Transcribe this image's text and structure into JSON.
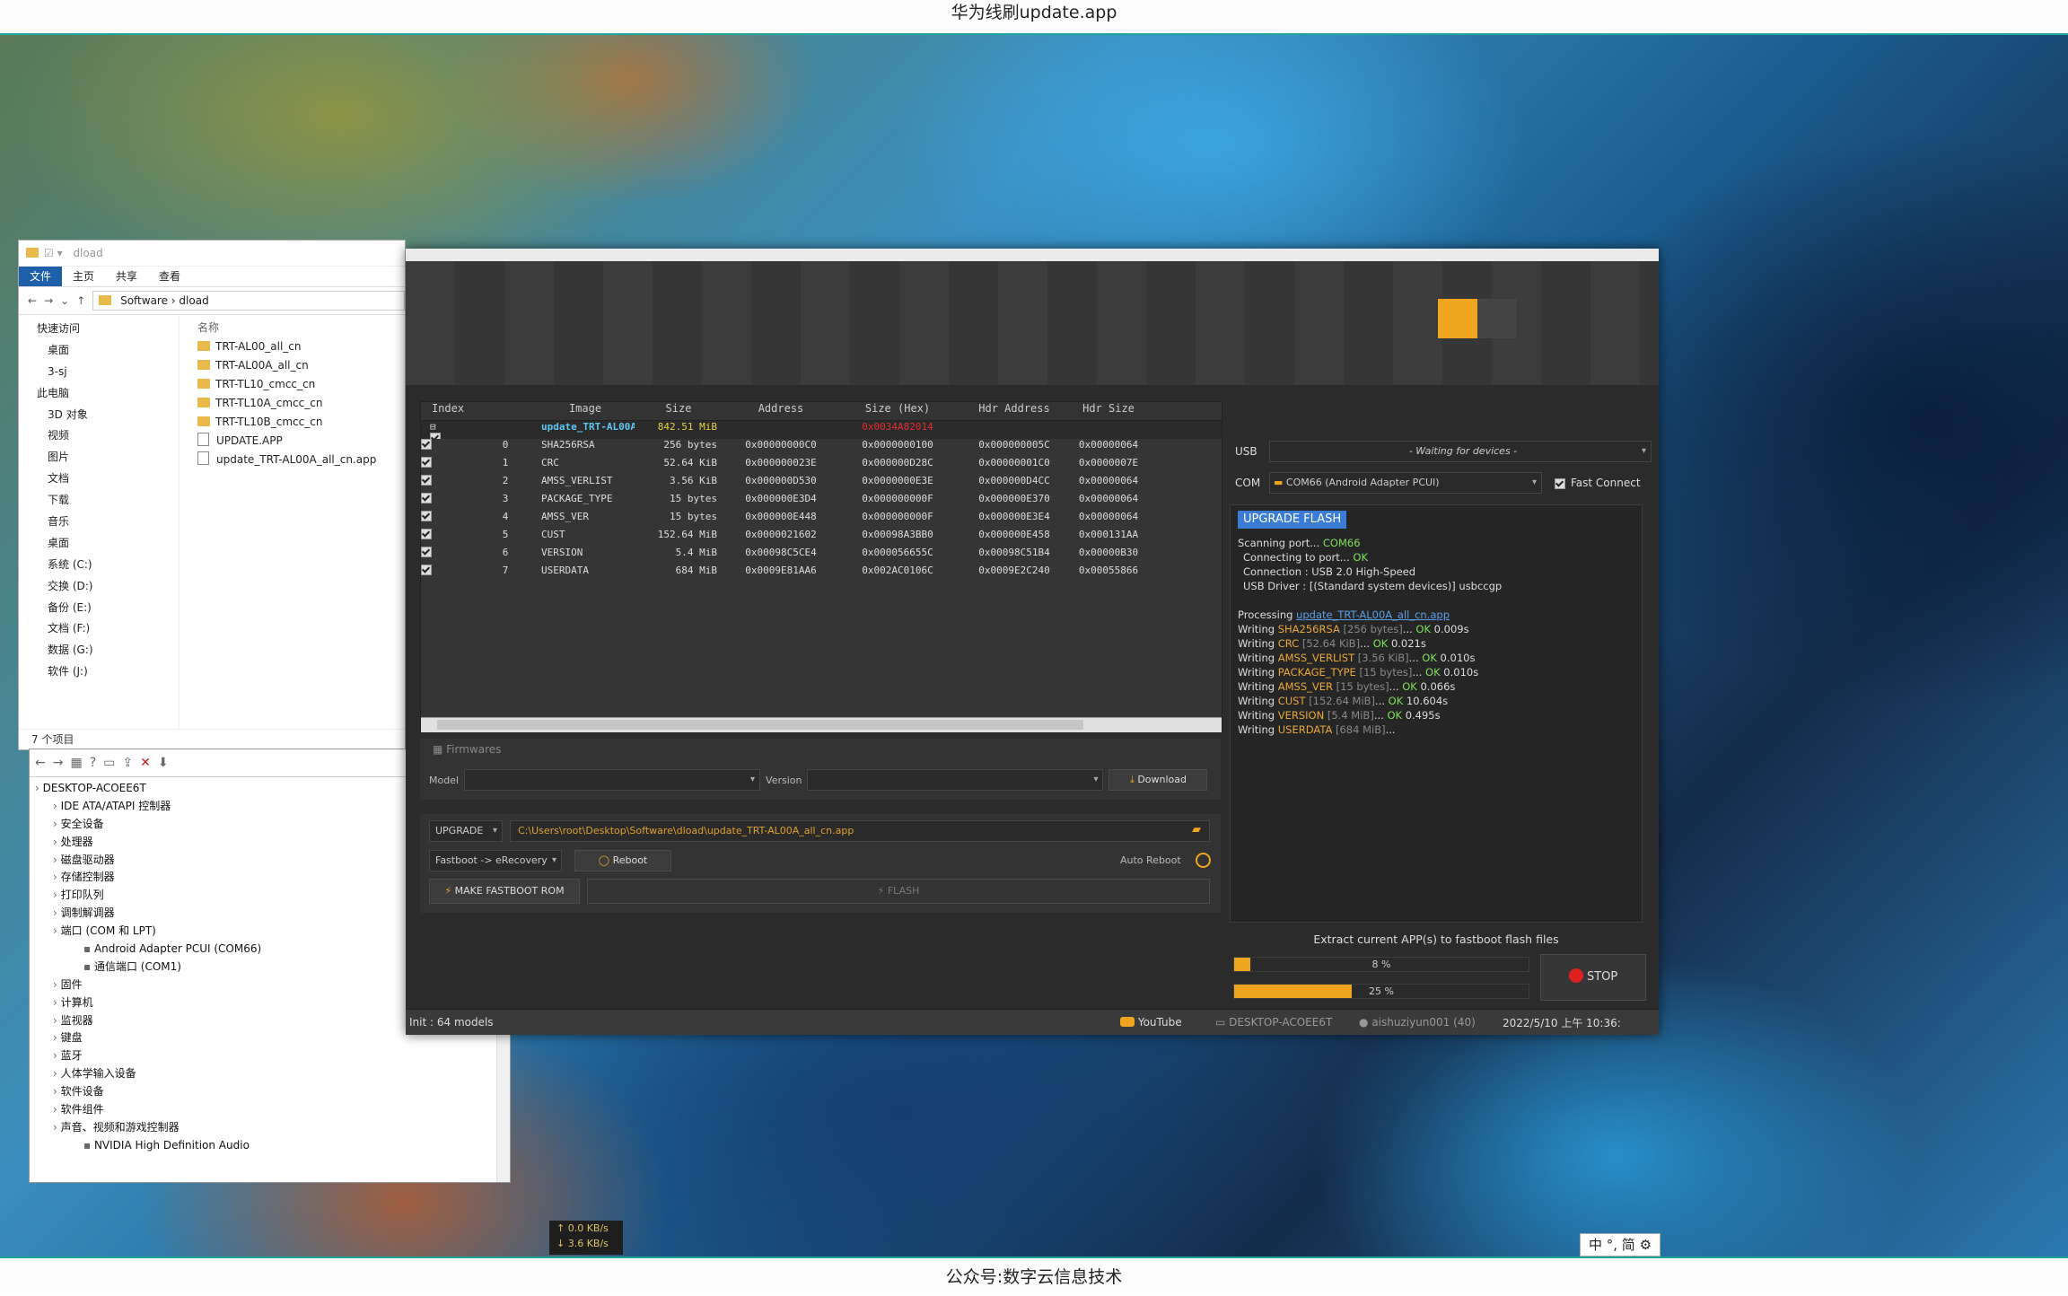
{
  "page": {
    "top_title": "华为线刷update.app",
    "bottom_caption": "公众号:数字云信息技术"
  },
  "explorer": {
    "title": "dload",
    "tabs": [
      "文件",
      "主页",
      "共享",
      "查看"
    ],
    "breadcrumb": [
      "Software",
      "dload"
    ],
    "column_name": "名称",
    "nav": [
      {
        "label": "快速访问",
        "level": 0
      },
      {
        "label": "桌面",
        "level": 1
      },
      {
        "label": "3-sj",
        "level": 1
      },
      {
        "label": "此电脑",
        "level": 0
      },
      {
        "label": "3D 对象",
        "level": 1
      },
      {
        "label": "视频",
        "level": 1
      },
      {
        "label": "图片",
        "level": 1
      },
      {
        "label": "文档",
        "level": 1
      },
      {
        "label": "下载",
        "level": 1
      },
      {
        "label": "音乐",
        "level": 1
      },
      {
        "label": "桌面",
        "level": 1
      },
      {
        "label": "系统 (C:)",
        "level": 1
      },
      {
        "label": "交换 (D:)",
        "level": 1
      },
      {
        "label": "备份 (E:)",
        "level": 1
      },
      {
        "label": "文档 (F:)",
        "level": 1
      },
      {
        "label": "数据 (G:)",
        "level": 1
      },
      {
        "label": "软件 (J:)",
        "level": 1
      }
    ],
    "files": [
      {
        "name": "TRT-AL00_all_cn",
        "type": "folder"
      },
      {
        "name": "TRT-AL00A_all_cn",
        "type": "folder"
      },
      {
        "name": "TRT-TL10_cmcc_cn",
        "type": "folder"
      },
      {
        "name": "TRT-TL10A_cmcc_cn",
        "type": "folder"
      },
      {
        "name": "TRT-TL10B_cmcc_cn",
        "type": "folder"
      },
      {
        "name": "UPDATE.APP",
        "type": "file"
      },
      {
        "name": "update_TRT-AL00A_all_cn.app",
        "type": "file"
      }
    ],
    "status": "7 个项目"
  },
  "device_manager": {
    "tree": [
      {
        "label": "DESKTOP-ACOEE6T",
        "level": 0
      },
      {
        "label": "IDE ATA/ATAPI 控制器",
        "level": 1
      },
      {
        "label": "安全设备",
        "level": 1
      },
      {
        "label": "处理器",
        "level": 1
      },
      {
        "label": "磁盘驱动器",
        "level": 1
      },
      {
        "label": "存储控制器",
        "level": 1
      },
      {
        "label": "打印队列",
        "level": 1
      },
      {
        "label": "调制解调器",
        "level": 1
      },
      {
        "label": "端口 (COM 和 LPT)",
        "level": 1
      },
      {
        "label": "Android Adapter PCUI (COM66)",
        "level": 2
      },
      {
        "label": "通信端口 (COM1)",
        "level": 2
      },
      {
        "label": "固件",
        "level": 1
      },
      {
        "label": "计算机",
        "level": 1
      },
      {
        "label": "监视器",
        "level": 1
      },
      {
        "label": "键盘",
        "level": 1
      },
      {
        "label": "蓝牙",
        "level": 1
      },
      {
        "label": "人体学输入设备",
        "level": 1
      },
      {
        "label": "软件设备",
        "level": 1
      },
      {
        "label": "软件组件",
        "level": 1
      },
      {
        "label": "声音、视频和游戏控制器",
        "level": 1
      },
      {
        "label": "NVIDIA High Definition Audio",
        "level": 2
      }
    ]
  },
  "tool": {
    "columns": [
      "Index",
      "Image",
      "Size",
      "Address",
      "Size (Hex)",
      "Hdr Address",
      "Hdr Size"
    ],
    "parent_row": {
      "image": "update_TRT-AL00A_al...",
      "size": "842.51 MiB",
      "size_hex": "0x0034A82014"
    },
    "rows": [
      {
        "index": "0",
        "image": "SHA256RSA",
        "size": "256 bytes",
        "address": "0x00000000C0",
        "size_hex": "0x0000000100",
        "hdr_address": "0x000000005C",
        "hdr_size": "0x00000064"
      },
      {
        "index": "1",
        "image": "CRC",
        "size": "52.64 KiB",
        "address": "0x000000023E",
        "size_hex": "0x000000D28C",
        "hdr_address": "0x00000001C0",
        "hdr_size": "0x0000007E"
      },
      {
        "index": "2",
        "image": "AMSS_VERLIST",
        "size": "3.56 KiB",
        "address": "0x000000D530",
        "size_hex": "0x0000000E3E",
        "hdr_address": "0x000000D4CC",
        "hdr_size": "0x00000064"
      },
      {
        "index": "3",
        "image": "PACKAGE_TYPE",
        "size": "15 bytes",
        "address": "0x000000E3D4",
        "size_hex": "0x000000000F",
        "hdr_address": "0x000000E370",
        "hdr_size": "0x00000064"
      },
      {
        "index": "4",
        "image": "AMSS_VER",
        "size": "15 bytes",
        "address": "0x000000E448",
        "size_hex": "0x000000000F",
        "hdr_address": "0x000000E3E4",
        "hdr_size": "0x00000064"
      },
      {
        "index": "5",
        "image": "CUST",
        "size": "152.64 MiB",
        "address": "0x0000021602",
        "size_hex": "0x00098A3BB0",
        "hdr_address": "0x000000E458",
        "hdr_size": "0x000131AA"
      },
      {
        "index": "6",
        "image": "VERSION",
        "size": "5.4 MiB",
        "address": "0x00098C5CE4",
        "size_hex": "0x000056655C",
        "hdr_address": "0x00098C51B4",
        "hdr_size": "0x00000B30"
      },
      {
        "index": "7",
        "image": "USERDATA",
        "size": "684 MiB",
        "address": "0x0009E81AA6",
        "size_hex": "0x002AC0106C",
        "hdr_address": "0x0009E2C240",
        "hdr_size": "0x00055866"
      }
    ],
    "firmwares_title": "Firmwares",
    "model_label": "Model",
    "version_label": "Version",
    "download_label": "Download",
    "mode_value": "UPGRADE",
    "file_path": "C:\\Users\\root\\Desktop\\Software\\dload\\update_TRT-AL00A_all_cn.app",
    "reboot_mode": "Fastboot -> eRecovery",
    "reboot_label": "Reboot",
    "auto_reboot_label": "Auto Reboot",
    "make_rom_label": "MAKE FASTBOOT ROM",
    "flash_label": "FLASH",
    "usb_label": "USB",
    "usb_value": "- Waiting for devices -",
    "com_label": "COM",
    "com_value": "COM66 (Android Adapter PCUI)",
    "fast_connect_label": "Fast Connect",
    "upgrade_badge": "UPGRADE FLASH",
    "log": {
      "scan_prefix": "Scanning port... ",
      "scan_port": "COM66",
      "connect_prefix": "Connecting to port... ",
      "connect_ok": "OK",
      "connection": "Connection : USB 2.0 High-Speed",
      "driver": "USB Driver : [(Standard system devices)] usbccgp",
      "processing_prefix": "Processing ",
      "processing_file": "update_TRT-AL00A_all_cn.app",
      "writes": [
        {
          "name": "SHA256RSA",
          "size": "[256 bytes]",
          "result": "OK",
          "time": "0.009s"
        },
        {
          "name": "CRC",
          "size": "[52.64 KiB]",
          "result": "OK",
          "time": "0.021s"
        },
        {
          "name": "AMSS_VERLIST",
          "size": "[3.56 KiB]",
          "result": "OK",
          "time": "0.010s"
        },
        {
          "name": "PACKAGE_TYPE",
          "size": "[15 bytes]",
          "result": "OK",
          "time": "0.010s"
        },
        {
          "name": "AMSS_VER",
          "size": "[15 bytes]",
          "result": "OK",
          "time": "0.066s"
        },
        {
          "name": "CUST",
          "size": "[152.64 MiB]",
          "result": "OK",
          "time": "10.604s"
        },
        {
          "name": "VERSION",
          "size": "[5.4 MiB]",
          "result": "OK",
          "time": "0.495s"
        },
        {
          "name": "USERDATA",
          "size": "[684 MiB]",
          "result": "",
          "time": ""
        }
      ]
    },
    "extract_label": "Extract current APP(s) to fastboot flash files",
    "progress1": {
      "percent": 8,
      "label": "8 %"
    },
    "progress2": {
      "percent": 25,
      "label": "25 %"
    },
    "stop_label": "STOP",
    "status_left": "Init : 64 models",
    "status_youtube": "YouTube",
    "status_host": "DESKTOP-ACOEE6T",
    "status_user": "aishuziyun001 (40)",
    "status_time": "2022/5/10 上午 10:36:"
  },
  "netmon": {
    "up": "↑ 0.0 KB/s",
    "down": "↓ 3.6 KB/s"
  },
  "ime": "中 °, 简",
  "colors": {
    "accent": "#f0a520",
    "ok": "#7ee05a",
    "badge": "#3a7bd5",
    "stop": "#e02020"
  }
}
